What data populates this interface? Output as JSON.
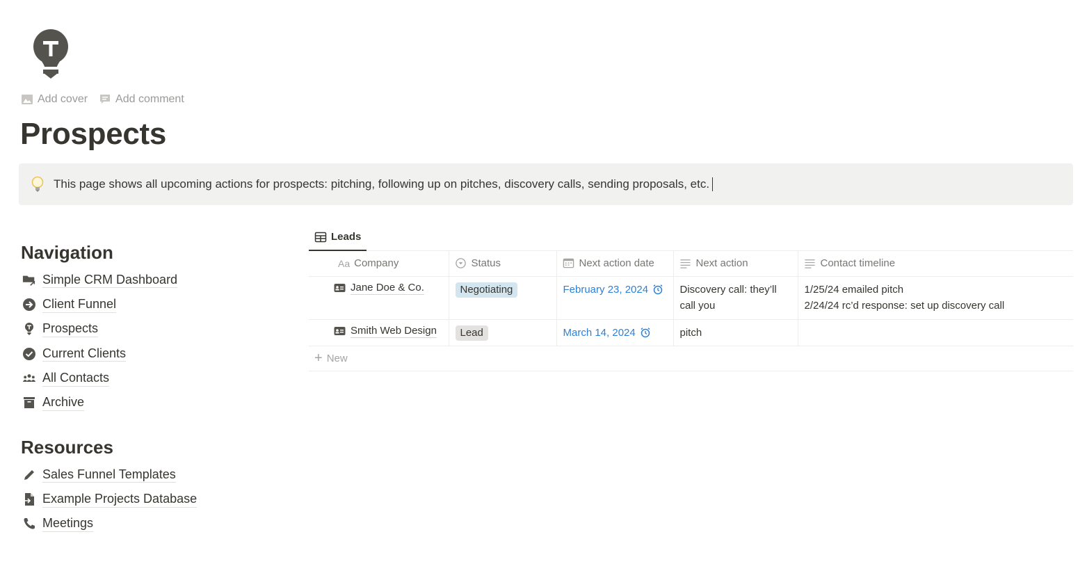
{
  "page": {
    "icon": "lightbulb-t-icon",
    "actions": [
      {
        "label": "Add cover",
        "icon": "image-icon"
      },
      {
        "label": "Add comment",
        "icon": "comment-icon"
      }
    ],
    "title": "Prospects"
  },
  "callout": {
    "icon": "lightbulb-icon",
    "text": "This page shows all upcoming actions for prospects: pitching, following up on pitches, discovery calls, sending proposals, etc."
  },
  "navigation": {
    "heading": "Navigation",
    "items": [
      {
        "label": "Simple CRM Dashboard",
        "icon": "folder-link-icon"
      },
      {
        "label": "Client Funnel",
        "icon": "arrow-circle-icon"
      },
      {
        "label": "Prospects",
        "icon": "lightbulb-icon"
      },
      {
        "label": "Current Clients",
        "icon": "check-circle-icon"
      },
      {
        "label": "All Contacts",
        "icon": "people-icon"
      },
      {
        "label": "Archive",
        "icon": "archive-icon"
      }
    ]
  },
  "resources": {
    "heading": "Resources",
    "items": [
      {
        "label": "Sales Funnel Templates",
        "icon": "pencil-icon"
      },
      {
        "label": "Example Projects Database",
        "icon": "document-import-icon"
      },
      {
        "label": "Meetings",
        "icon": "phone-icon"
      }
    ]
  },
  "database": {
    "tabs": [
      {
        "label": "Leads",
        "icon": "table-icon",
        "active": true
      }
    ],
    "columns": [
      {
        "label": "Company",
        "icon": "title-aa-icon"
      },
      {
        "label": "Status",
        "icon": "status-icon"
      },
      {
        "label": "Next action date",
        "icon": "calendar-icon"
      },
      {
        "label": "Next action",
        "icon": "text-lines-icon"
      },
      {
        "label": "Contact timeline",
        "icon": "text-lines-icon"
      }
    ],
    "rows": [
      {
        "company": "Jane Doe & Co.",
        "status": "Negotiating",
        "next_action_date": "February 23, 2024",
        "next_action": "Discovery call: they’ll call you",
        "contact_timeline": [
          "1/25/24 emailed pitch",
          "2/24/24 rc’d response: set up discovery call"
        ]
      },
      {
        "company": "Smith Web Design",
        "status": "Lead",
        "next_action_date": "March 14, 2024",
        "next_action": "pitch",
        "contact_timeline": []
      }
    ],
    "status_colors": {
      "Negotiating": "#d3e5ef",
      "Lead": "#e3e2e0"
    },
    "date_color": "#2f80d4",
    "new_label": "New"
  }
}
